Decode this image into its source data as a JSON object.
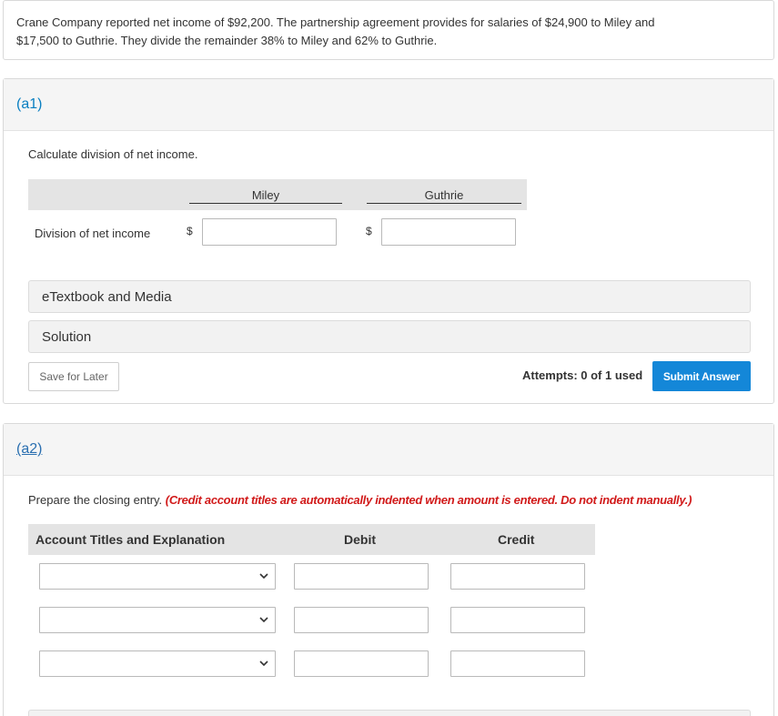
{
  "intro": {
    "line1": "Crane Company reported net income of $92,200. The partnership agreement provides for salaries of $24,900 to Miley and",
    "line2": "$17,500 to Guthrie. They divide the remainder 38% to Miley and 62% to Guthrie."
  },
  "part_a1": {
    "label": "(a1)",
    "instruction": "Calculate division of net income.",
    "columns": [
      "Miley",
      "Guthrie"
    ],
    "row_label": "Division of net income",
    "currency_symbol": "$",
    "inputs": {
      "miley_value": "",
      "guthrie_value": ""
    },
    "accordions": [
      "eTextbook and Media",
      "Solution"
    ],
    "save_label": "Save for Later",
    "attempts": "Attempts: 0 of 1 used",
    "submit_label": "Submit Answer"
  },
  "part_a2": {
    "label": "(a2)",
    "instruction": "Prepare the closing entry.",
    "instruction_note": "(Credit account titles are automatically indented when amount is entered. Do not indent manually.)",
    "columns": [
      "Account Titles and Explanation",
      "Debit",
      "Credit"
    ],
    "rows": [
      {
        "account": "",
        "debit": "",
        "credit": ""
      },
      {
        "account": "",
        "debit": "",
        "credit": ""
      },
      {
        "account": "",
        "debit": "",
        "credit": ""
      }
    ]
  },
  "colors": {
    "accent": "#1487d8",
    "link": "#0a7fc1",
    "warning_text": "#d11a1a",
    "header_bg": "#e4e4e4"
  },
  "icons": {
    "select_chevron": "chevron-down-icon"
  }
}
